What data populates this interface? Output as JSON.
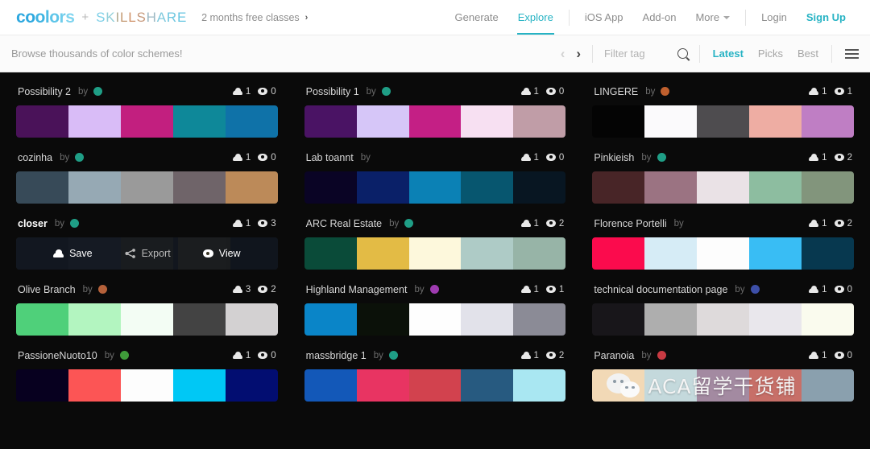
{
  "topbar": {
    "logo_text": "coolors",
    "logo_colors": [
      "#2ea8df",
      "#2ea8df",
      "#3fb4e2",
      "#4dbde6",
      "#5ec5e9",
      "#6fcdec",
      "#7fd4ef"
    ],
    "plus": "+",
    "partner_text": "SKILLSHARE",
    "partner_colors": [
      "#7fd0e8",
      "#92cfd9",
      "#b0a98f",
      "#c49a73",
      "#cf9168",
      "#c79a7d",
      "#9db9c4",
      "#7fc9dd",
      "#6fc7e0",
      "#68c6e2"
    ],
    "promo": "2 months free classes",
    "promo_arrow": "›",
    "nav": [
      {
        "label": "Generate",
        "active": false
      },
      {
        "label": "Explore",
        "active": true
      }
    ],
    "nav2": [
      {
        "label": "iOS App"
      },
      {
        "label": "Add-on"
      },
      {
        "label": "More",
        "caret": true
      }
    ],
    "login": "Login",
    "signup": "Sign Up",
    "accent_color": "#27b3c4"
  },
  "subbar": {
    "tagline": "Browse thousands of color schemes!",
    "prev": "‹",
    "next": "›",
    "filter_placeholder": "Filter tag",
    "sorts": [
      {
        "label": "Latest",
        "active": true
      },
      {
        "label": "Picks",
        "active": false
      },
      {
        "label": "Best",
        "active": false
      }
    ]
  },
  "hover_overlay": {
    "save": "Save",
    "export": "Export",
    "view": "View"
  },
  "watermark": {
    "text": "ACA留学干货铺"
  },
  "columns": [
    {
      "cards": [
        {
          "name": "Possibility 2",
          "by": "by",
          "avatar": "#1f9e86",
          "saves": "1",
          "views": "0",
          "hovered": false,
          "bold": false,
          "colors": [
            "#4a1259",
            "#d9bcf7",
            "#c21f7f",
            "#0e8899",
            "#0f72a8"
          ]
        },
        {
          "name": "cozinha",
          "by": "by",
          "avatar": "#1f9e86",
          "saves": "1",
          "views": "0",
          "hovered": false,
          "bold": false,
          "colors": [
            "#374a58",
            "#96a9b4",
            "#9a9a9a",
            "#6f6469",
            "#bc8a59"
          ]
        },
        {
          "name": "closer",
          "by": "by",
          "avatar": "#1f9e86",
          "saves": "1",
          "views": "3",
          "hovered": true,
          "bold": true,
          "colors": [
            "#2c3440",
            "#3a4250",
            "#4a4a3c",
            "#2b2f39",
            "#222832"
          ]
        },
        {
          "name": "Olive Branch",
          "by": "by",
          "avatar": "#b5613a",
          "saves": "3",
          "views": "2",
          "hovered": false,
          "bold": false,
          "colors": [
            "#4fd07a",
            "#b3f5c0",
            "#f3fdf4",
            "#434343",
            "#d3d1d2"
          ]
        },
        {
          "name": "PassioneNuoto10",
          "by": "by",
          "avatar": "#3f9c3a",
          "saves": "1",
          "views": "0",
          "hovered": false,
          "bold": false,
          "colors": [
            "#07001f",
            "#fc5555",
            "#fdfdfd",
            "#00c8f5",
            "#020d71"
          ]
        }
      ]
    },
    {
      "cards": [
        {
          "name": "Possibility 1",
          "by": "by",
          "avatar": "#1f9e86",
          "saves": "1",
          "views": "0",
          "hovered": false,
          "bold": false,
          "colors": [
            "#4a1364",
            "#d6c6f8",
            "#c41f85",
            "#f7e0f2",
            "#c09da7"
          ]
        },
        {
          "name": "Lab toannt",
          "by": "by",
          "avatar": null,
          "saves": "1",
          "views": "0",
          "hovered": false,
          "bold": false,
          "colors": [
            "#0a0425",
            "#0a2068",
            "#0b81b5",
            "#07566f",
            "#081622"
          ]
        },
        {
          "name": "ARC Real Estate",
          "by": "by",
          "avatar": "#1f9e86",
          "saves": "1",
          "views": "2",
          "hovered": false,
          "bold": false,
          "colors": [
            "#0a4b39",
            "#e3bb45",
            "#fdf8dc",
            "#aecbc6",
            "#97b4a7"
          ]
        },
        {
          "name": "Highland Management",
          "by": "by",
          "avatar": "#9e3bb0",
          "saves": "1",
          "views": "1",
          "hovered": false,
          "bold": false,
          "colors": [
            "#0a85c8",
            "#0b1109",
            "#fefefe",
            "#e2e2ea",
            "#8b8b96"
          ]
        },
        {
          "name": "massbridge 1",
          "by": "by",
          "avatar": "#1f9e86",
          "saves": "1",
          "views": "2",
          "hovered": false,
          "bold": false,
          "colors": [
            "#1358b8",
            "#e83462",
            "#d2424e",
            "#275a80",
            "#a9e7f2"
          ]
        }
      ]
    },
    {
      "cards": [
        {
          "name": "LINGERE",
          "by": "by",
          "avatar": "#c0602e",
          "saves": "1",
          "views": "1",
          "hovered": false,
          "bold": false,
          "colors": [
            "#040404",
            "#fbfafc",
            "#4e4c4f",
            "#eeada3",
            "#bf7ec4"
          ]
        },
        {
          "name": "Pinkieish",
          "by": "by",
          "avatar": "#1f9e86",
          "saves": "1",
          "views": "2",
          "hovered": false,
          "bold": false,
          "colors": [
            "#482527",
            "#9b7382",
            "#eae2e6",
            "#8dbda0",
            "#82957c"
          ]
        },
        {
          "name": "Florence Portelli",
          "by": "by",
          "avatar": null,
          "saves": "1",
          "views": "2",
          "hovered": false,
          "bold": false,
          "colors": [
            "#fb0b4d",
            "#d6ecf6",
            "#fdfdfd",
            "#39bdf4",
            "#07384f"
          ]
        },
        {
          "name": "technical documentation page",
          "by": "by",
          "avatar": "#3d4fa8",
          "saves": "1",
          "views": "0",
          "hovered": false,
          "bold": false,
          "colors": [
            "#18161a",
            "#aeaeae",
            "#dedadb",
            "#e9e7ec",
            "#fafbee"
          ]
        },
        {
          "name": "Paranoia",
          "by": "by",
          "avatar": "#c83a42",
          "saves": "1",
          "views": "0",
          "hovered": false,
          "bold": false,
          "watermark": true,
          "colors": [
            "#f2d9b6",
            "#c4d9dc",
            "#a38aa1",
            "#c76f68",
            "#8aa0ae"
          ]
        }
      ]
    }
  ]
}
